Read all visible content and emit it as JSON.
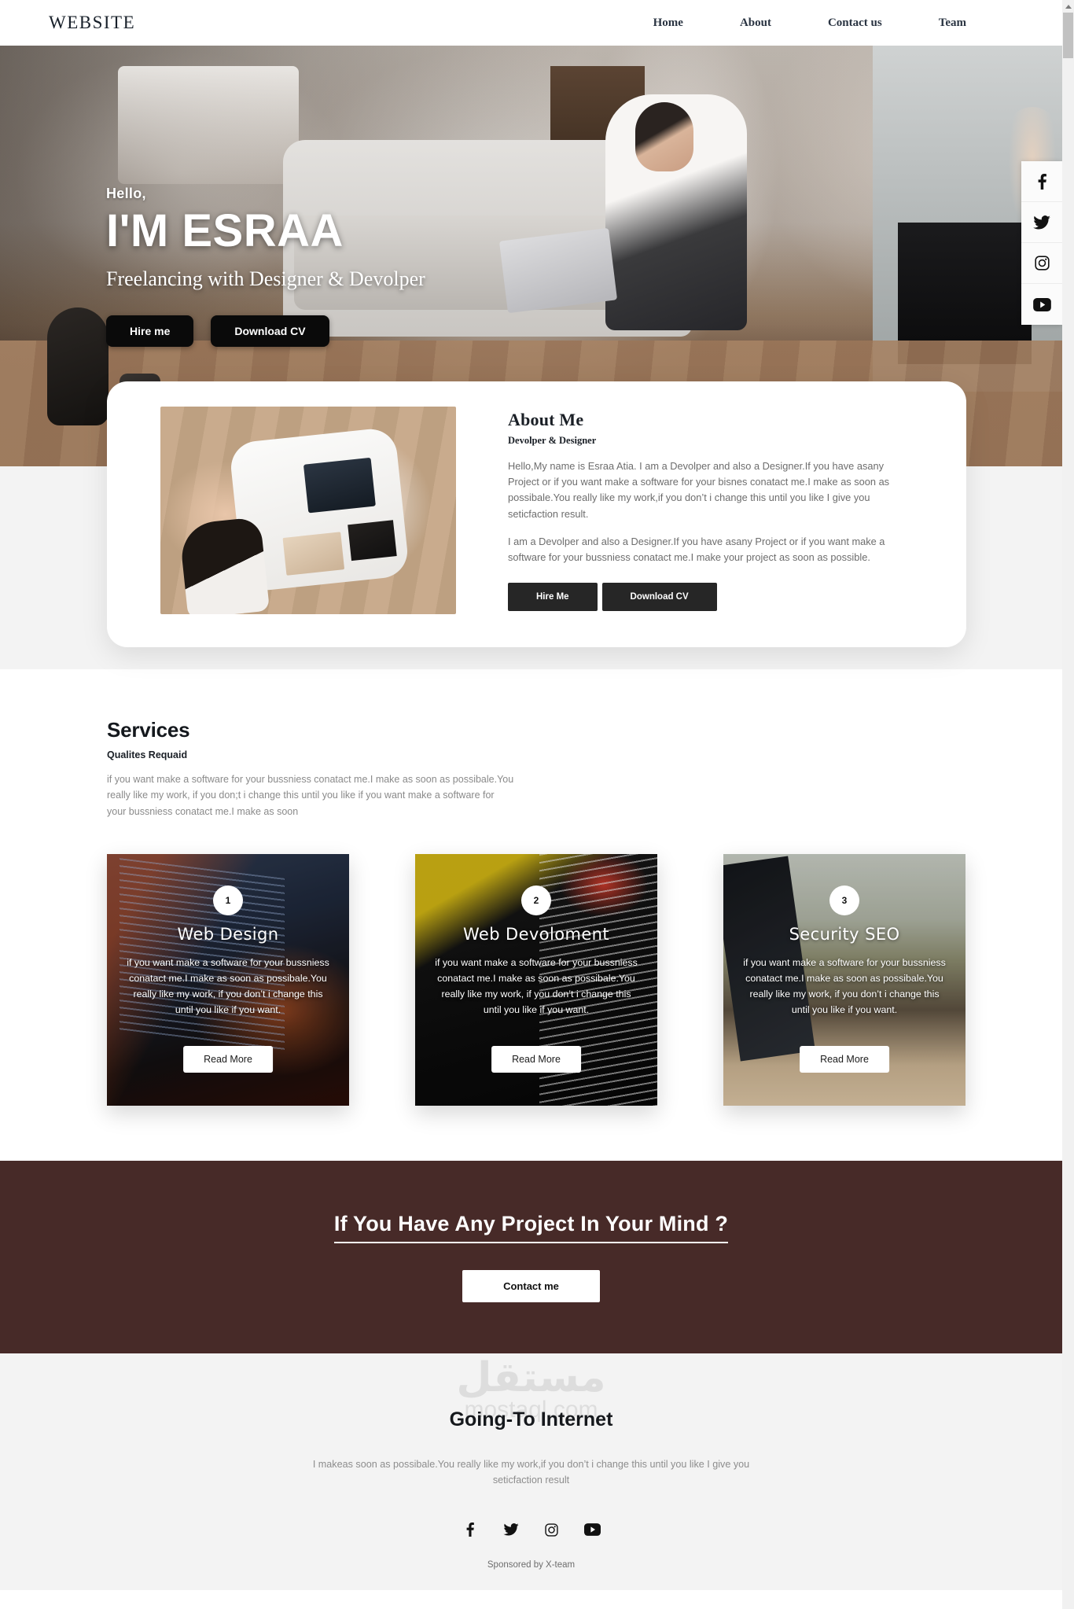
{
  "nav": {
    "brand": "WEBSITE",
    "links": [
      "Home",
      "About",
      "Contact us",
      "Team"
    ]
  },
  "hero": {
    "hello": "Hello,",
    "name": "I'M ESRAA",
    "subtitle": "Freelancing with Designer & Devolper",
    "buttons": [
      "Hire me",
      "Download CV"
    ]
  },
  "social_rail": [
    {
      "name": "facebook-icon",
      "glyph": "f"
    },
    {
      "name": "twitter-icon",
      "glyph": "t"
    },
    {
      "name": "instagram-icon",
      "glyph": "i"
    },
    {
      "name": "youtube-icon",
      "glyph": "y"
    }
  ],
  "about": {
    "title": "About Me",
    "role": "Devolper & Designer",
    "paragraph1": "Hello,My name is Esraa Atia. I am a Devolper and also a Designer.If you have asany Project or if you want make a software for your bisnes conatact me.I make as soon as possibale.You really like my work,if you don’t i change this until you like I give you seticfaction result.",
    "paragraph2": "I am a Devolper and also a Designer.If you have asany Project or if you want make a software for your bussniess conatact me.I make your project as soon as possible.",
    "buttons": [
      "Hire Me",
      "Download CV"
    ]
  },
  "services": {
    "title": "Services",
    "subtitle": "Qualites Requaid",
    "description": "if you want make a software for your bussniess conatact me.I make as soon as possibale.You really like my work, if you don;t i change this until you like if you want make a software for your bussniess conatact me.I make as soon",
    "cards": [
      {
        "badge": "1",
        "title": "Web Design",
        "text": "if you want make a software for your bussniess conatact me.I make as soon as possibale.You really like my work, if you don’t i change this until you like if you want.",
        "button": "Read More"
      },
      {
        "badge": "2",
        "title": "Web Devoloment",
        "text": "if you want make a software for your bussniess conatact me.I make as soon as possibale.You really like my work, if you don’t i change this until you like if you want.",
        "button": "Read More"
      },
      {
        "badge": "3",
        "title": "Security SEO",
        "text": "if you want make a software for your bussniess conatact me.I make as soon as possibale.You really like my work, if you don’t i change this until you like if you want.",
        "button": "Read More"
      }
    ]
  },
  "cta": {
    "title": "If You Have Any Project In Your Mind ?",
    "button": "Contact me",
    "background_color": "#472a28"
  },
  "footer": {
    "title": "Going-To Internet",
    "description": "I makeas soon as possibale.You really like my work,if you don’t i change this until you like I give you seticfaction result",
    "socials": [
      {
        "name": "facebook-icon"
      },
      {
        "name": "twitter-icon"
      },
      {
        "name": "instagram-icon"
      },
      {
        "name": "youtube-icon"
      }
    ],
    "credit": "Sponsored by X-team",
    "watermark_arabic": "مستقل",
    "watermark_latin": "mostaql.com"
  }
}
